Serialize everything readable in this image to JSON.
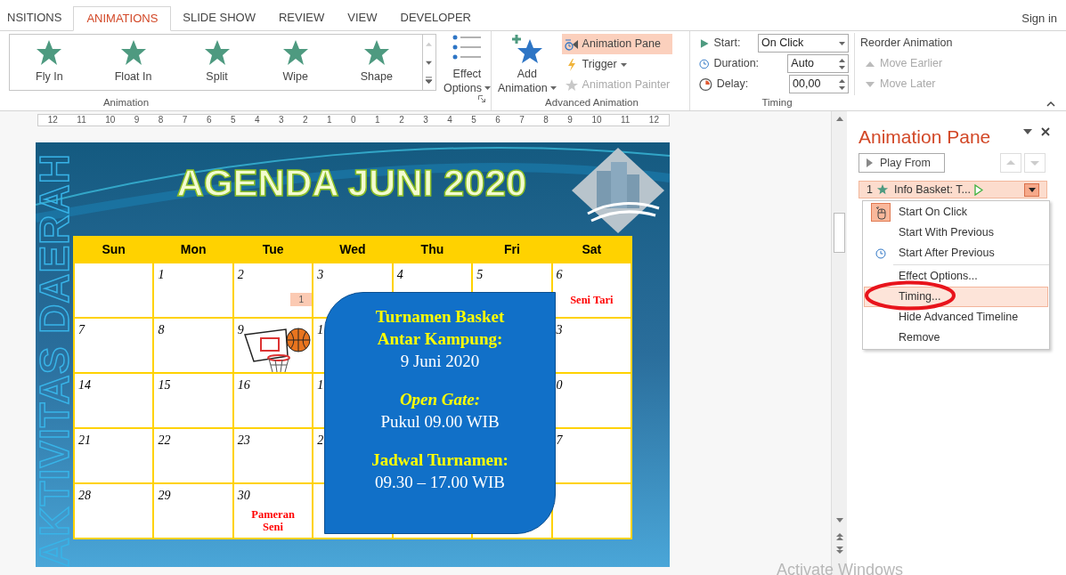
{
  "tabs": [
    {
      "label": "NSITIONS",
      "selected": false
    },
    {
      "label": "ANIMATIONS",
      "selected": true
    },
    {
      "label": "SLIDE SHOW",
      "selected": false
    },
    {
      "label": "REVIEW",
      "selected": false
    },
    {
      "label": "VIEW",
      "selected": false
    },
    {
      "label": "DEVELOPER",
      "selected": false
    }
  ],
  "account": {
    "label": "Sign in"
  },
  "ribbon": {
    "animation_group": {
      "label": "Animation",
      "effects": [
        {
          "label": "Fly In",
          "selected": false
        },
        {
          "label": "Float In",
          "selected": false
        },
        {
          "label": "Split",
          "selected": false
        },
        {
          "label": "Wipe",
          "selected": false
        },
        {
          "label": "Shape",
          "selected": false
        }
      ],
      "effect_options": {
        "label_1": "Effect",
        "label_2": "Options"
      }
    },
    "advanced_group": {
      "label": "Advanced Animation",
      "add_animation": {
        "label_1": "Add",
        "label_2": "Animation"
      },
      "commands": [
        {
          "label": "Animation Pane",
          "selected": true,
          "disabled": false,
          "dropdown": false
        },
        {
          "label": "Trigger",
          "selected": false,
          "disabled": false,
          "dropdown": true
        },
        {
          "label": "Animation Painter",
          "selected": false,
          "disabled": true,
          "dropdown": false
        }
      ]
    },
    "timing_group": {
      "label": "Timing",
      "fields": [
        {
          "label": "Start:",
          "value": "On Click",
          "kind": "dropdown"
        },
        {
          "label": "Duration:",
          "value": "Auto",
          "kind": "spinner"
        },
        {
          "label": "Delay:",
          "value": "00,00",
          "kind": "spinner"
        }
      ],
      "reorder": {
        "label": "Reorder Animation",
        "commands": [
          {
            "label": "Move Earlier",
            "disabled": true
          },
          {
            "label": "Move Later",
            "disabled": true
          }
        ]
      }
    }
  },
  "ruler": {
    "labels": [
      "12",
      "11",
      "10",
      "9",
      "8",
      "7",
      "6",
      "5",
      "4",
      "3",
      "2",
      "1",
      "0",
      "1",
      "2",
      "3",
      "4",
      "5",
      "6",
      "7",
      "8",
      "9",
      "10",
      "11",
      "12"
    ]
  },
  "slide": {
    "side_title": "AKTIVITAS DAERAH",
    "title": "AGENDA JUNI 2020",
    "calendar": {
      "days": [
        "Sun",
        "Mon",
        "Tue",
        "Wed",
        "Thu",
        "Fri",
        "Sat"
      ],
      "rows": [
        [
          {},
          {
            "day": "1"
          },
          {
            "day": "2",
            "animation_tag": "1"
          },
          {
            "day": "3"
          },
          {
            "day": "4"
          },
          {
            "day": "5"
          },
          {
            "day": "6",
            "event": "Seni Tari"
          }
        ],
        [
          {
            "day": "7"
          },
          {
            "day": "8"
          },
          {
            "day": "9",
            "picture": true
          },
          {
            "day": "1"
          },
          {},
          {},
          {
            "day": "3"
          }
        ],
        [
          {
            "day": "14"
          },
          {
            "day": "15"
          },
          {
            "day": "16"
          },
          {
            "day": "1"
          },
          {},
          {},
          {
            "day": "0"
          }
        ],
        [
          {
            "day": "21"
          },
          {
            "day": "22"
          },
          {
            "day": "23"
          },
          {
            "day": "2"
          },
          {},
          {},
          {
            "day": "7"
          }
        ],
        [
          {
            "day": "28"
          },
          {
            "day": "29"
          },
          {
            "day": "30",
            "event": "Pameran Seni"
          },
          {},
          {},
          {},
          {}
        ]
      ]
    },
    "callout": {
      "blocks": [
        {
          "lines": [
            {
              "text": "Turnamen Basket",
              "kind": "heading"
            },
            {
              "text": "Antar Kampung:",
              "kind": "heading"
            },
            {
              "text": "9 Juni 2020",
              "kind": "body"
            }
          ]
        },
        {
          "lines": [
            {
              "text": "Open Gate:",
              "kind": "heading-italic"
            },
            {
              "text": "Pukul 09.00 WIB",
              "kind": "body"
            }
          ]
        },
        {
          "lines": [
            {
              "text": "Jadwal Turnamen:",
              "kind": "heading"
            },
            {
              "text": "09.30 – 17.00 WIB",
              "kind": "body"
            }
          ]
        }
      ]
    }
  },
  "animation_pane": {
    "title": "Animation Pane",
    "play_button": "Play From",
    "items": [
      {
        "number": "1",
        "label": "Info Basket: T...",
        "selected": true
      }
    ],
    "menu": [
      {
        "label": "Start On Click",
        "kind": "on-click",
        "checked": true,
        "selected": false
      },
      {
        "label": "Start With Previous",
        "kind": "with-previous",
        "checked": false,
        "selected": false
      },
      {
        "label": "Start After Previous",
        "kind": "after-previous",
        "checked": false,
        "selected": false
      },
      {
        "label": "Effect Options...",
        "kind": "command",
        "selected": false
      },
      {
        "label": "Timing...",
        "kind": "command",
        "selected": true
      },
      {
        "label": "Hide Advanced Timeline",
        "kind": "command",
        "selected": false
      },
      {
        "label": "Remove",
        "kind": "command",
        "selected": false
      }
    ]
  },
  "watermark": {
    "text": "Activate Windows"
  }
}
